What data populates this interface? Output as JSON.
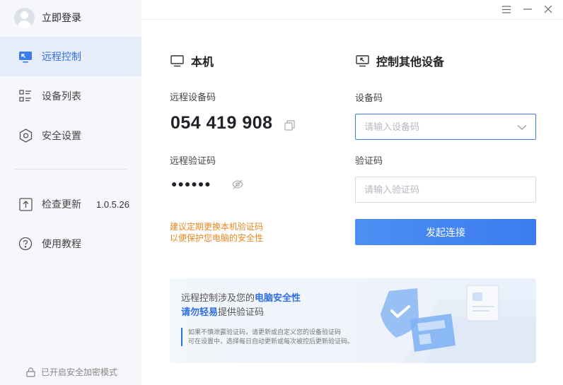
{
  "sidebar": {
    "login_label": "立即登录",
    "items": [
      {
        "label": "远程控制",
        "icon": "monitor-remote-icon",
        "active": true
      },
      {
        "label": "设备列表",
        "icon": "list-icon",
        "active": false
      },
      {
        "label": "安全设置",
        "icon": "shield-hex-icon",
        "active": false
      },
      {
        "label": "检查更新",
        "icon": "upload-icon",
        "active": false
      },
      {
        "label": "使用教程",
        "icon": "help-icon",
        "active": false
      }
    ],
    "version": "1.0.5.26",
    "footer": "已开启安全加密模式"
  },
  "titlebar": {
    "buttons": [
      "menu-icon",
      "minimize-icon",
      "close-icon"
    ]
  },
  "local": {
    "title": "本机",
    "device_code_label": "远程设备码",
    "device_code": "054 419 908",
    "verify_label": "远程验证码",
    "verify_masked": "●●●●●●",
    "tip_line1": "建议定期更换本机验证码",
    "tip_line2": "以便保护您电脑的安全性"
  },
  "remote": {
    "title": "控制其他设备",
    "device_code_label": "设备码",
    "device_code_placeholder": "请输入设备码",
    "verify_label": "验证码",
    "verify_placeholder": "请输入验证码",
    "connect_label": "发起连接"
  },
  "banner": {
    "line1_prefix": "远程控制涉及您的",
    "line1_highlight": "电脑安全性",
    "line2_highlight": "请勿轻易",
    "line2_suffix": "提供验证码",
    "note_line1": "如果不慎泄露验证码，请更新或自定义您的设备验证码",
    "note_line2": "可在设置中，选择每日自动更新或每次被控后更新验证码。"
  },
  "colors": {
    "accent": "#2f6fe4",
    "warning": "#e8871e",
    "sidebar_bg": "#f5f7fa",
    "active_bg": "#e6edf8"
  }
}
